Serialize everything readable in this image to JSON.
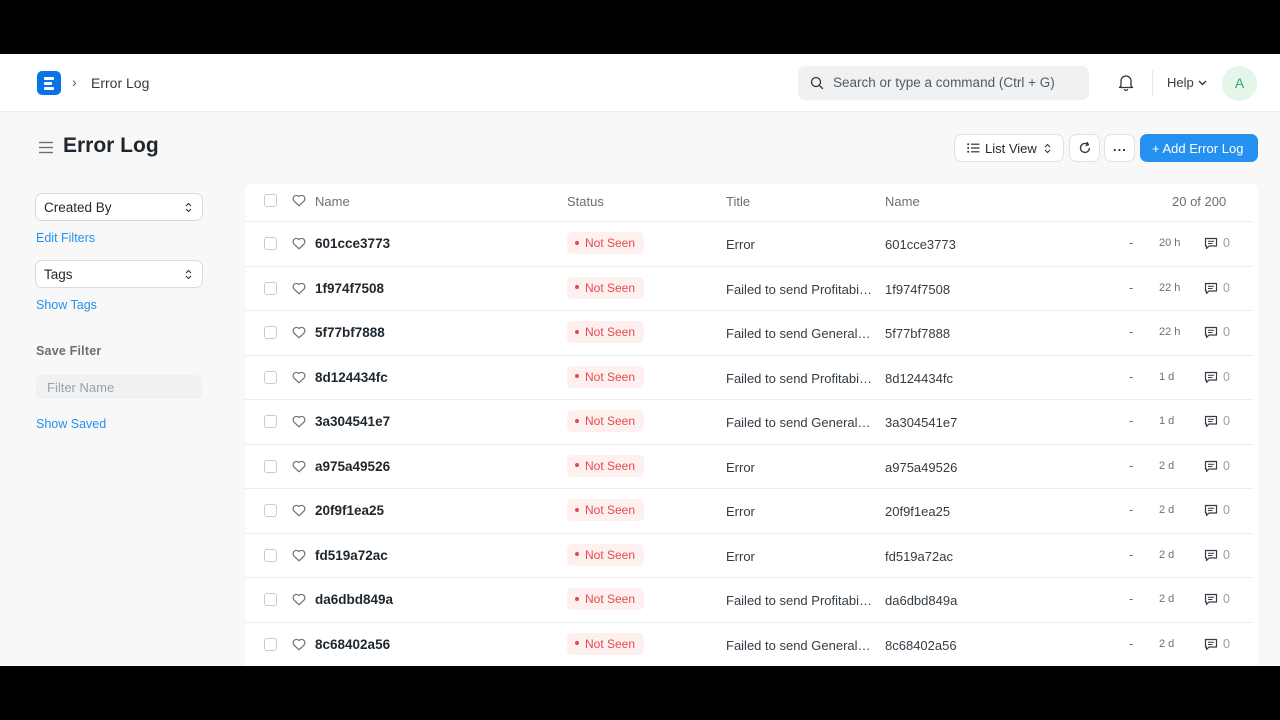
{
  "navbar": {
    "breadcrumb": "Error Log",
    "search_placeholder": "Search or type a command (Ctrl + G)",
    "help_label": "Help",
    "avatar_initial": "A"
  },
  "page": {
    "title": "Error Log",
    "list_view_label": "List View",
    "more_label": "...",
    "add_button_label": "+ Add Error Log"
  },
  "sidebar": {
    "created_by_label": "Created By",
    "edit_filters": "Edit Filters",
    "tags_label": "Tags",
    "show_tags": "Show Tags",
    "save_filter_heading": "Save Filter",
    "filter_name_placeholder": "Filter Name",
    "show_saved": "Show Saved"
  },
  "table": {
    "columns": [
      "Name",
      "Status",
      "Title",
      "Name"
    ],
    "count": "20 of 200",
    "rows": [
      {
        "name": "601cce3773",
        "status": "Not Seen",
        "title": "Error",
        "name2": "601cce3773",
        "dash": "-",
        "time": "20 h",
        "comments": "0"
      },
      {
        "name": "1f974f7508",
        "status": "Not Seen",
        "title": "Failed to send Profitability Report",
        "name2": "1f974f7508",
        "dash": "-",
        "time": "22 h",
        "comments": "0"
      },
      {
        "name": "5f77bf7888",
        "status": "Not Seen",
        "title": "Failed to send General Ledger Report",
        "name2": "5f77bf7888",
        "dash": "-",
        "time": "22 h",
        "comments": "0"
      },
      {
        "name": "8d124434fc",
        "status": "Not Seen",
        "title": "Failed to send Profitability Report",
        "name2": "8d124434fc",
        "dash": "-",
        "time": "1 d",
        "comments": "0"
      },
      {
        "name": "3a304541e7",
        "status": "Not Seen",
        "title": "Failed to send General Ledger Report",
        "name2": "3a304541e7",
        "dash": "-",
        "time": "1 d",
        "comments": "0"
      },
      {
        "name": "a975a49526",
        "status": "Not Seen",
        "title": "Error",
        "name2": "a975a49526",
        "dash": "-",
        "time": "2 d",
        "comments": "0"
      },
      {
        "name": "20f9f1ea25",
        "status": "Not Seen",
        "title": "Error",
        "name2": "20f9f1ea25",
        "dash": "-",
        "time": "2 d",
        "comments": "0"
      },
      {
        "name": "fd519a72ac",
        "status": "Not Seen",
        "title": "Error",
        "name2": "fd519a72ac",
        "dash": "-",
        "time": "2 d",
        "comments": "0"
      },
      {
        "name": "da6dbd849a",
        "status": "Not Seen",
        "title": "Failed to send Profitability Report",
        "name2": "da6dbd849a",
        "dash": "-",
        "time": "2 d",
        "comments": "0"
      },
      {
        "name": "8c68402a56",
        "status": "Not Seen",
        "title": "Failed to send General Ledger Report",
        "name2": "8c68402a56",
        "dash": "-",
        "time": "2 d",
        "comments": "0"
      }
    ]
  },
  "colors": {
    "brand": "#0b74e5",
    "primary": "#2490ef",
    "status_red": "#e24c4c",
    "status_bg": "#fff0f0"
  },
  "icons": [
    "frappe-logo-icon",
    "chevron-right-icon",
    "search-icon",
    "bell-icon",
    "chevron-down-icon",
    "menu-icon",
    "list-icon",
    "sort-icon",
    "refresh-icon",
    "heart-icon",
    "comment-icon"
  ]
}
